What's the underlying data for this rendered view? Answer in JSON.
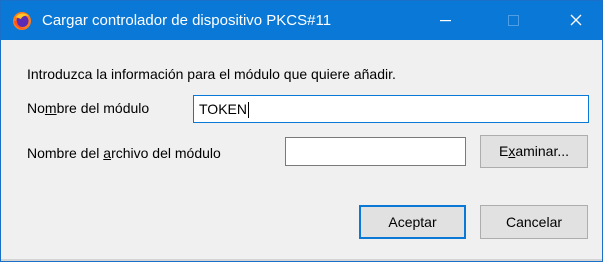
{
  "window": {
    "title": "Cargar controlador de dispositivo PKCS#11",
    "app_icon": "firefox-icon",
    "titlebar_color": "#0a78d7",
    "controls": {
      "minimize_glyph": "—",
      "maximize_glyph": "☐",
      "close_glyph": "✕"
    }
  },
  "dialog": {
    "intro": "Introduzca la información para el módulo que quiere añadir.",
    "module_name": {
      "label_pre": "No",
      "label_accel": "m",
      "label_post": "bre del módulo",
      "value": "TOKEN"
    },
    "module_file": {
      "label_pre": "Nombre del ",
      "label_accel": "a",
      "label_post": "rchivo del módulo",
      "value": ""
    },
    "browse_button": {
      "pre": "E",
      "accel": "x",
      "post": "aminar..."
    },
    "ok_label": "Aceptar",
    "cancel_label": "Cancelar"
  }
}
